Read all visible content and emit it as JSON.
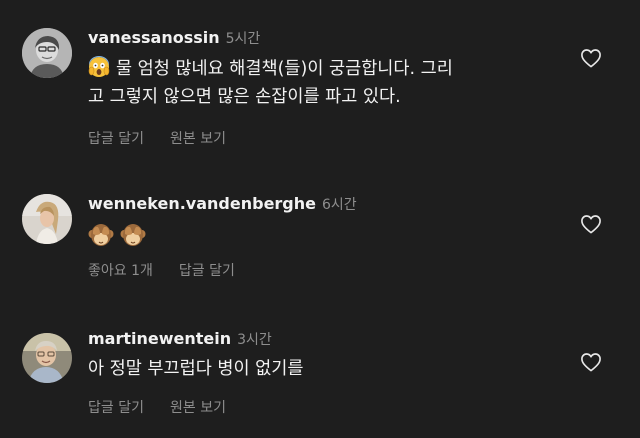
{
  "comments": [
    {
      "username": "vanessanossin",
      "time": "5시간",
      "text_line1": "물 엄청 많네요 해결책(들)이 궁금합니다. 그리",
      "text_line2": "고 그렇지 않으면 많은 손잡이를 파고 있다.",
      "emoji": "screaming-face",
      "actions": [
        "답글 달기",
        "원본 보기"
      ]
    },
    {
      "username": "wenneken.vandenberghe",
      "time": "6시간",
      "emoji": "see-no-evil-monkey",
      "emoji_count": 2,
      "actions": [
        "좋아요 1개",
        "답글 달기"
      ]
    },
    {
      "username": "martinewentein",
      "time": "3시간",
      "text_line1": "아 정말 부끄럽다 병이 없기를",
      "actions": [
        "답글 달기",
        "원본 보기"
      ]
    }
  ],
  "colors": {
    "background": "#1e1e1e",
    "primary_text": "#f2f2f2",
    "secondary_text": "#8e8e8e"
  }
}
